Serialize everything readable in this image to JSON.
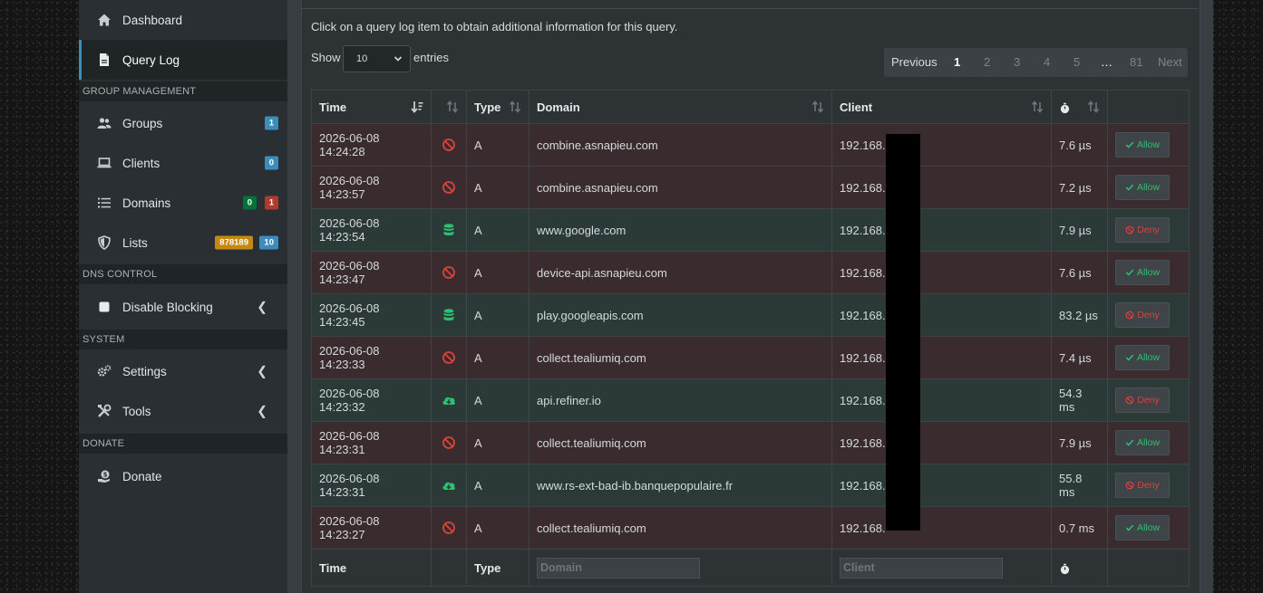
{
  "sidebar": {
    "items": [
      {
        "label": "Dashboard",
        "icon": "home-icon"
      },
      {
        "label": "Query Log",
        "icon": "file-icon",
        "active": true
      }
    ],
    "sections": {
      "group_management": "GROUP MANAGEMENT",
      "dns_control": "DNS CONTROL",
      "system": "SYSTEM",
      "donate": "DONATE"
    },
    "groups": {
      "label": "Groups",
      "badge": "1"
    },
    "clients": {
      "label": "Clients",
      "badge": "0"
    },
    "domains": {
      "label": "Domains",
      "badge_allow": "0",
      "badge_deny": "1"
    },
    "lists": {
      "label": "Lists",
      "badge_domains": "878189",
      "badge_lists": "10"
    },
    "disable_blocking": {
      "label": "Disable Blocking"
    },
    "settings": {
      "label": "Settings"
    },
    "tools": {
      "label": "Tools"
    },
    "donate_item": {
      "label": "Donate"
    }
  },
  "main": {
    "intro": "Click on a query log item to obtain additional information for this query.",
    "show_label": "Show",
    "entries_value": "10",
    "entries_label": "entries",
    "pagination": {
      "previous": "Previous",
      "pages": [
        "1",
        "2",
        "3",
        "4",
        "5",
        "…",
        "81"
      ],
      "current": "1",
      "next": "Next"
    },
    "table": {
      "headers": {
        "time": "Time",
        "type": "Type",
        "domain": "Domain",
        "client": "Client"
      },
      "rows": [
        {
          "time": "2026-06-08 14:24:28",
          "status": "blocked",
          "type": "A",
          "domain": "combine.asnapieu.com",
          "client": "192.168.",
          "reply": "7.6 µs",
          "action": "Allow"
        },
        {
          "time": "2026-06-08 14:23:57",
          "status": "blocked",
          "type": "A",
          "domain": "combine.asnapieu.com",
          "client": "192.168.",
          "reply": "7.2 µs",
          "action": "Allow"
        },
        {
          "time": "2026-06-08 14:23:54",
          "status": "cached",
          "type": "A",
          "domain": "www.google.com",
          "client": "192.168.",
          "reply": "7.9 µs",
          "action": "Deny"
        },
        {
          "time": "2026-06-08 14:23:47",
          "status": "blocked",
          "type": "A",
          "domain": "device-api.asnapieu.com",
          "client": "192.168.",
          "reply": "7.6 µs",
          "action": "Allow"
        },
        {
          "time": "2026-06-08 14:23:45",
          "status": "cached",
          "type": "A",
          "domain": "play.googleapis.com",
          "client": "192.168.",
          "reply": "83.2 µs",
          "action": "Deny"
        },
        {
          "time": "2026-06-08 14:23:33",
          "status": "blocked",
          "type": "A",
          "domain": "collect.tealiumiq.com",
          "client": "192.168.",
          "reply": "7.4 µs",
          "action": "Allow"
        },
        {
          "time": "2026-06-08 14:23:32",
          "status": "forwarded",
          "type": "A",
          "domain": "api.refiner.io",
          "client": "192.168.",
          "reply": "54.3 ms",
          "action": "Deny"
        },
        {
          "time": "2026-06-08 14:23:31",
          "status": "blocked",
          "type": "A",
          "domain": "collect.tealiumiq.com",
          "client": "192.168.",
          "reply": "7.9 µs",
          "action": "Allow"
        },
        {
          "time": "2026-06-08 14:23:31",
          "status": "forwarded",
          "type": "A",
          "domain": "www.rs-ext-bad-ib.banquepopulaire.fr",
          "client": "192.168.",
          "reply": "55.8 ms",
          "action": "Deny"
        },
        {
          "time": "2026-06-08 14:23:27",
          "status": "blocked",
          "type": "A",
          "domain": "collect.tealiumiq.com",
          "client": "192.168.",
          "reply": "0.7 ms",
          "action": "Allow"
        }
      ],
      "footer": {
        "time": "Time",
        "type": "Type",
        "domain_placeholder": "Domain",
        "client_placeholder": "Client"
      }
    }
  },
  "colors": {
    "accent": "#3c8dbc",
    "blocked_row": "#3a2c2e",
    "allowed_row": "#2b3a37",
    "allow_green": "#2fbf71",
    "deny_red": "#d9443a"
  }
}
